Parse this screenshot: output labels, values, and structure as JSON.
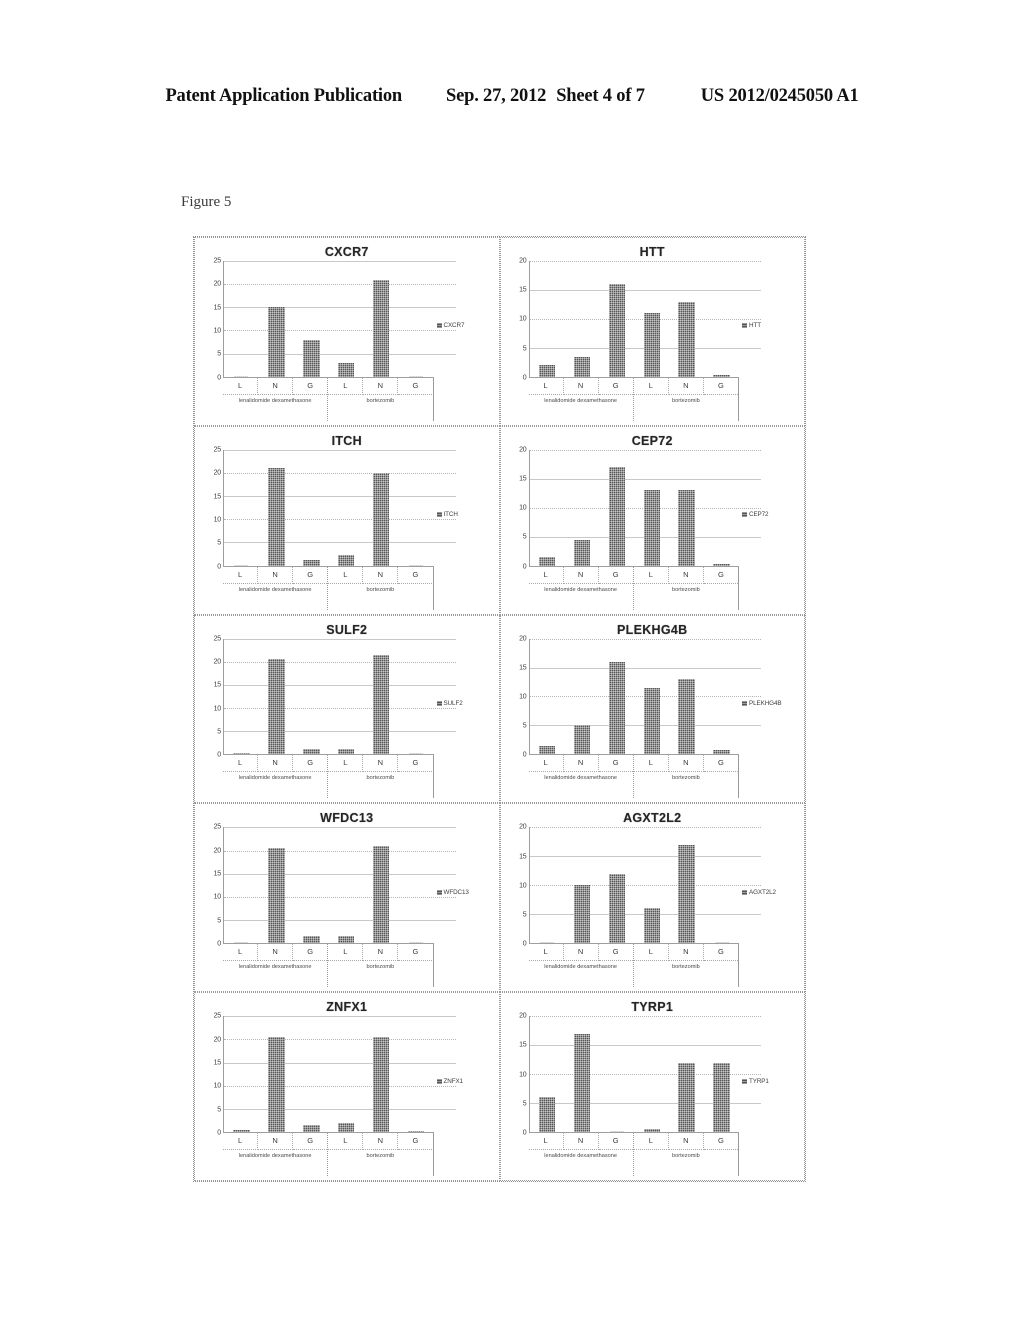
{
  "header": {
    "publication": "Patent Application Publication",
    "date": "Sep. 27, 2012",
    "sheet": "Sheet 4 of 7",
    "patent_number": "US 2012/0245050 A1"
  },
  "figure": {
    "label": "Figure 5"
  },
  "axis": {
    "group_labels": [
      "lenalidomide dexamethasone",
      "bortezomib"
    ],
    "category_labels": [
      "L",
      "N",
      "G",
      "L",
      "N",
      "G"
    ]
  },
  "chart_data": [
    {
      "type": "bar",
      "title": "CXCR7",
      "categories": [
        "L",
        "N",
        "G",
        "L",
        "N",
        "G"
      ],
      "values": [
        0,
        15,
        8,
        3,
        21,
        0
      ],
      "legend": "CXCR7",
      "yticks": [
        0,
        5,
        10,
        15,
        20,
        25
      ],
      "ylim": [
        0,
        25
      ],
      "xlabel": "",
      "ylabel": "",
      "grid": true,
      "legend_position": "right"
    },
    {
      "type": "bar",
      "title": "HTT",
      "categories": [
        "L",
        "N",
        "G",
        "L",
        "N",
        "G"
      ],
      "values": [
        2,
        3.5,
        16,
        11,
        13,
        0.3
      ],
      "legend": "HTT",
      "yticks": [
        0,
        5,
        10,
        15,
        20
      ],
      "ylim": [
        0,
        20
      ],
      "xlabel": "",
      "ylabel": "",
      "grid": true,
      "legend_position": "right"
    },
    {
      "type": "bar",
      "title": "ITCH",
      "categories": [
        "L",
        "N",
        "G",
        "L",
        "N",
        "G"
      ],
      "values": [
        0,
        21,
        1.2,
        2.2,
        20,
        0
      ],
      "legend": "ITCH",
      "yticks": [
        0,
        5,
        10,
        15,
        20,
        25
      ],
      "ylim": [
        0,
        25
      ],
      "xlabel": "",
      "ylabel": "",
      "grid": true,
      "legend_position": "right"
    },
    {
      "type": "bar",
      "title": "CEP72",
      "categories": [
        "L",
        "N",
        "G",
        "L",
        "N",
        "G"
      ],
      "values": [
        1.5,
        4.5,
        17,
        13,
        13,
        0.3
      ],
      "legend": "CEP72",
      "yticks": [
        0,
        5,
        10,
        15,
        20
      ],
      "ylim": [
        0,
        20
      ],
      "xlabel": "",
      "ylabel": "",
      "grid": true,
      "legend_position": "right"
    },
    {
      "type": "bar",
      "title": "SULF2",
      "categories": [
        "L",
        "N",
        "G",
        "L",
        "N",
        "G"
      ],
      "values": [
        0.3,
        20.5,
        1.2,
        1.2,
        21.5,
        0
      ],
      "legend": "SULF2",
      "yticks": [
        0,
        5,
        10,
        15,
        20,
        25
      ],
      "ylim": [
        0,
        25
      ],
      "xlabel": "",
      "ylabel": "",
      "grid": true,
      "legend_position": "right"
    },
    {
      "type": "bar",
      "title": "PLEKHG4B",
      "categories": [
        "L",
        "N",
        "G",
        "L",
        "N",
        "G"
      ],
      "values": [
        1.5,
        5,
        16,
        11.5,
        13,
        0.8
      ],
      "legend": "PLEKHG4B",
      "yticks": [
        0,
        5,
        10,
        15,
        20
      ],
      "ylim": [
        0,
        20
      ],
      "xlabel": "",
      "ylabel": "",
      "grid": true,
      "legend_position": "right"
    },
    {
      "type": "bar",
      "title": "WFDC13",
      "categories": [
        "L",
        "N",
        "G",
        "L",
        "N",
        "G"
      ],
      "values": [
        0,
        20.5,
        1.5,
        1.5,
        21,
        0
      ],
      "legend": "WFDC13",
      "yticks": [
        0,
        5,
        10,
        15,
        20,
        25
      ],
      "ylim": [
        0,
        25
      ],
      "xlabel": "",
      "ylabel": "",
      "grid": true,
      "legend_position": "right"
    },
    {
      "type": "bar",
      "title": "AGXT2L2",
      "categories": [
        "L",
        "N",
        "G",
        "L",
        "N",
        "G"
      ],
      "values": [
        0,
        10,
        12,
        6,
        17,
        0
      ],
      "legend": "AGXT2L2",
      "yticks": [
        0,
        5,
        10,
        15,
        20
      ],
      "ylim": [
        0,
        20
      ],
      "xlabel": "",
      "ylabel": "",
      "grid": true,
      "legend_position": "right"
    },
    {
      "type": "bar",
      "title": "ZNFX1",
      "categories": [
        "L",
        "N",
        "G",
        "L",
        "N",
        "G"
      ],
      "values": [
        0.5,
        20.5,
        1.5,
        2,
        20.5,
        0.3
      ],
      "legend": "ZNFX1",
      "yticks": [
        0,
        5,
        10,
        15,
        20,
        25
      ],
      "ylim": [
        0,
        25
      ],
      "xlabel": "",
      "ylabel": "",
      "grid": true,
      "legend_position": "right"
    },
    {
      "type": "bar",
      "title": "TYRP1",
      "categories": [
        "L",
        "N",
        "G",
        "L",
        "N",
        "G"
      ],
      "values": [
        6,
        17,
        0,
        0.5,
        12,
        12
      ],
      "legend": "TYRP1",
      "yticks": [
        0,
        5,
        10,
        15,
        20
      ],
      "ylim": [
        0,
        20
      ],
      "xlabel": "",
      "ylabel": "",
      "grid": true,
      "legend_position": "right"
    }
  ],
  "colors": {
    "bar": "#555555",
    "gridline": "#b4b4b4",
    "axis": "#9e9e9e",
    "text": "#3a3a3a"
  }
}
